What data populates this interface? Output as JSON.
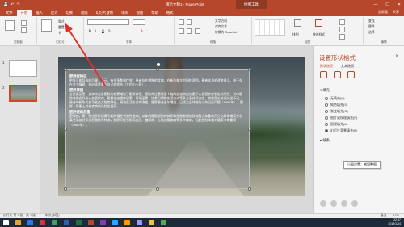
{
  "titlebar": {
    "title": "演示文稿1 - PowerPoint",
    "context_group": "绘图工具",
    "window_controls": [
      "—",
      "☐",
      "✕"
    ]
  },
  "tabs": [
    "文件",
    "开始",
    "插入",
    "设计",
    "切换",
    "动画",
    "幻灯片放映",
    "审阅",
    "视图",
    "帮助",
    "格式"
  ],
  "tabs_active_index": 1,
  "tabs_right": [
    "告诉我",
    "共享"
  ],
  "ribbon": {
    "groups": [
      {
        "label": "剪贴板"
      },
      {
        "label": "幻灯片"
      },
      {
        "label": "字体"
      },
      {
        "label": "段落"
      },
      {
        "label": "绘图"
      },
      {
        "label": "编辑"
      }
    ],
    "new_slide_label": "新建\n幻灯片",
    "layout_label": "版式",
    "reset_label": "重置",
    "section_label": "节",
    "arrange_label": "排列",
    "quick_styles_label": "快速样式",
    "find_label": "查找",
    "replace_label": "替换",
    "select_label": "选择",
    "text_direction_label": "文字方向",
    "align_text_label": "对齐文本",
    "smartart_label": "转换为 SmartArt"
  },
  "thumbnails": [
    {
      "number": "1"
    },
    {
      "number": "2"
    }
  ],
  "slide_text": {
    "sections": [
      {
        "heading": "肥胖症特征",
        "body": "肥胖可能导致的后果，多元。有很多数量疗效，患者存在哪种的疾病。在新年每次时间检测到，患者本身的改变很少。由于存在这个障碍，你必须注意到自己的状态（大约小一段）。"
      },
      {
        "heading": "肥胖原因",
        "body": "主要原因是：身体中过多脂肪的积累增加了肥胖体型。脂肪的比重需要人脑的血液供应加重了心血管疾病发生的风险，其中脂肪堆积会导致心血管疾病。肥胖症由遗传因素、环境因素、饮食习惯和生活方式等多方面共同决定。特别是长时间久坐不动，患者的新陈代谢功能会大幅度降低。随着生活方式的改变，肥胖患者逐年增加，已成为全球性的公共卫生问题（1994年）。肥胖人群患上其他疾病的风险也更高。"
      },
      {
        "heading": "肥胖症的危害",
        "body": "肥胖症，是一种由多种因素引起的慢性代谢性疾病，以体内脂肪细胞的体积和细胞数增加致体脂占体重的百分比异常增高并在某些局部过多沉积脂肪为特点。肥胖可能引发高血压、糖尿病、心脑血管疾病等多种疾病，因此控制体重对健康非常重要（1982年）。"
      }
    ]
  },
  "format_pane": {
    "title": "设置形状格式",
    "tabs": [
      "形状选项",
      "文本选项"
    ],
    "fill_section": "填充",
    "fill_options": [
      {
        "label": "无填充(N)",
        "selected": false
      },
      {
        "label": "纯色填充(S)",
        "selected": false
      },
      {
        "label": "渐变填充(G)",
        "selected": false
      },
      {
        "label": "图片或纹理填充(P)",
        "selected": false
      },
      {
        "label": "图案填充(A)",
        "selected": false
      },
      {
        "label": "幻灯片背景填充(B)",
        "selected": true
      }
    ],
    "line_section": "线条",
    "tooltip": "小窗设置：感知整图"
  },
  "statusbar": {
    "left": "幻灯片 第 2 张，共 2 张",
    "language": "中文(中国)",
    "notes": "备注",
    "zoom": "47%"
  },
  "taskbar": {
    "time": "22:37",
    "date": "2019/12/4"
  },
  "colors": {
    "accent": "#b7472a",
    "pane_accent": "#b7472a",
    "taskbar": "#1e2a3a",
    "arrow": "#e0302a"
  }
}
